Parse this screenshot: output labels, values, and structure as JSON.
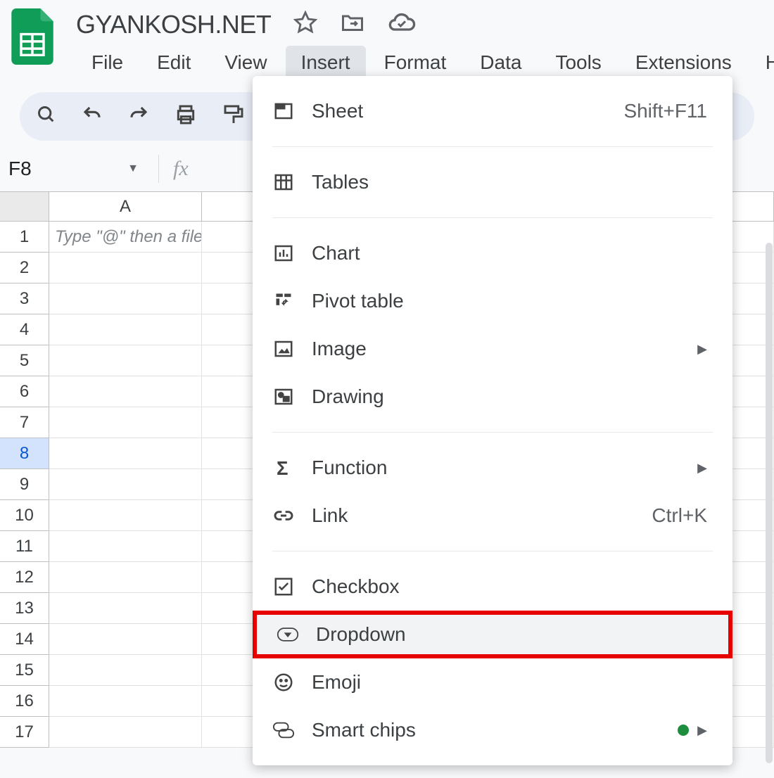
{
  "doc_title": "GYANKOSH.NET",
  "menu_bar": [
    "File",
    "Edit",
    "View",
    "Insert",
    "Format",
    "Data",
    "Tools",
    "Extensions",
    "Help"
  ],
  "active_menu_index": 3,
  "cell_reference": "F8",
  "col_headers": [
    "A"
  ],
  "placeholder_text": "Type \"@\" then a file na",
  "row_count": 17,
  "selected_row": 8,
  "insert_menu": {
    "groups": [
      [
        {
          "icon": "sheet",
          "label": "Sheet",
          "shortcut": "Shift+F11"
        }
      ],
      [
        {
          "icon": "tables",
          "label": "Tables"
        }
      ],
      [
        {
          "icon": "chart",
          "label": "Chart"
        },
        {
          "icon": "pivot",
          "label": "Pivot table"
        },
        {
          "icon": "image",
          "label": "Image",
          "submenu": true
        },
        {
          "icon": "drawing",
          "label": "Drawing"
        }
      ],
      [
        {
          "icon": "function",
          "label": "Function",
          "submenu": true
        },
        {
          "icon": "link",
          "label": "Link",
          "shortcut": "Ctrl+K"
        }
      ],
      [
        {
          "icon": "checkbox",
          "label": "Checkbox"
        },
        {
          "icon": "dropdown",
          "label": "Dropdown",
          "highlighted": true
        },
        {
          "icon": "emoji",
          "label": "Emoji"
        },
        {
          "icon": "smartchips",
          "label": "Smart chips",
          "greendot": true,
          "submenu": true
        }
      ]
    ]
  }
}
